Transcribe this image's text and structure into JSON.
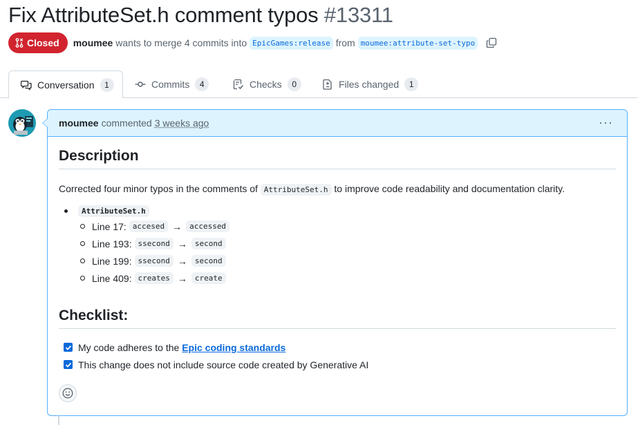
{
  "pr": {
    "title": "Fix AttributeSet.h comment typos",
    "number": "#13311",
    "state": "Closed",
    "author": "moumee",
    "meta_text": "wants to merge 4 commits into",
    "base_branch": "EpicGames:release",
    "from_text": "from",
    "head_branch": "moumee:attribute-set-typo"
  },
  "tabs": [
    {
      "label": "Conversation",
      "count": "1",
      "icon": "comment-discussion-icon"
    },
    {
      "label": "Commits",
      "count": "4",
      "icon": "git-commit-icon"
    },
    {
      "label": "Checks",
      "count": "0",
      "icon": "checklist-icon"
    },
    {
      "label": "Files changed",
      "count": "1",
      "icon": "file-diff-icon"
    }
  ],
  "comment": {
    "author": "moumee",
    "action": "commented",
    "time": "3 weeks ago",
    "description_heading": "Description",
    "para_before": "Corrected four minor typos in the comments of",
    "para_code": "AttributeSet.h",
    "para_after": "to improve code readability and documentation clarity.",
    "file": "AttributeSet.h",
    "fixes": [
      {
        "line": "Line 17:",
        "from": "accesed",
        "to": "accessed"
      },
      {
        "line": "Line 193:",
        "from": "ssecond",
        "to": "second"
      },
      {
        "line": "Line 199:",
        "from": "ssecond",
        "to": "second"
      },
      {
        "line": "Line 409:",
        "from": "creates",
        "to": "create"
      }
    ],
    "arrow": "→",
    "checklist_heading": "Checklist:",
    "check1_before": "My code adheres to the",
    "check1_link": "Epic coding standards",
    "check2": "This change does not include source code created by Generative AI"
  },
  "colors": {
    "closed": "#d1242f",
    "accent": "#0969da",
    "header_bg": "#ddf4ff"
  }
}
